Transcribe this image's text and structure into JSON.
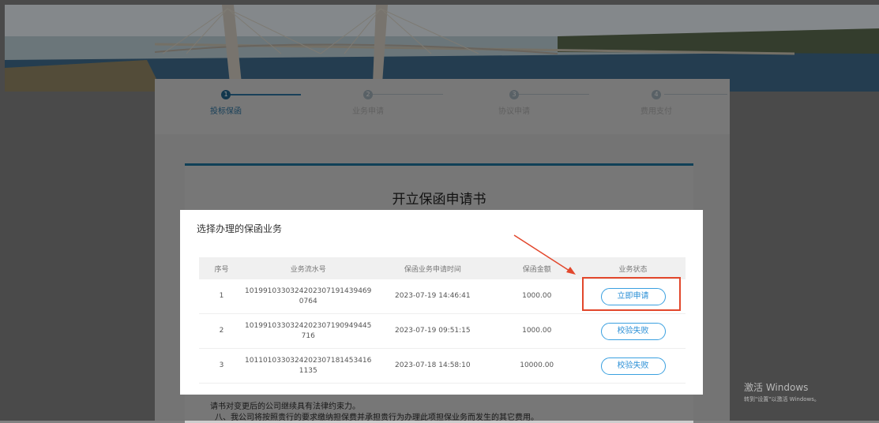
{
  "steps": [
    {
      "num": "1",
      "label": "投标保函",
      "active": true
    },
    {
      "num": "2",
      "label": "业务申请",
      "active": false
    },
    {
      "num": "3",
      "label": "协议申请",
      "active": false
    },
    {
      "num": "4",
      "label": "费用支付",
      "active": false
    }
  ],
  "document": {
    "title": "开立保函申请书",
    "line1": "请书对变更后的公司继续具有法律约束力。",
    "line2": "八、我公司将按照贵行的要求缴纳担保费并承担贵行为办理此项担保业务而发生的其它费用。"
  },
  "modal": {
    "title": "选择办理的保函业务",
    "columns": [
      "序号",
      "业务流水号",
      "保函业务申请时间",
      "保函金额",
      "业务状态"
    ],
    "rows": [
      {
        "index": "1",
        "serial_l1": "101991033032420230719143946​9",
        "serial_l2": "0764",
        "time": "2023-07-19 14:46:41",
        "amount": "1000.00",
        "status": "立即申请"
      },
      {
        "index": "2",
        "serial_l1": "1019910330324202307190949445",
        "serial_l2": "716",
        "time": "2023-07-19 09:51:15",
        "amount": "1000.00",
        "status": "校验失败"
      },
      {
        "index": "3",
        "serial_l1": "1011010330324202307181453416",
        "serial_l2": "1135",
        "time": "2023-07-18 14:58:10",
        "amount": "10000.00",
        "status": "校验失败"
      }
    ]
  },
  "watermark": {
    "line1": "激活 Windows",
    "line2": "转到\"设置\"以激活 Windows。"
  },
  "colors": {
    "accent": "#2a8fd6",
    "highlight": "#e2472c",
    "step_active": "#1f5f86"
  }
}
